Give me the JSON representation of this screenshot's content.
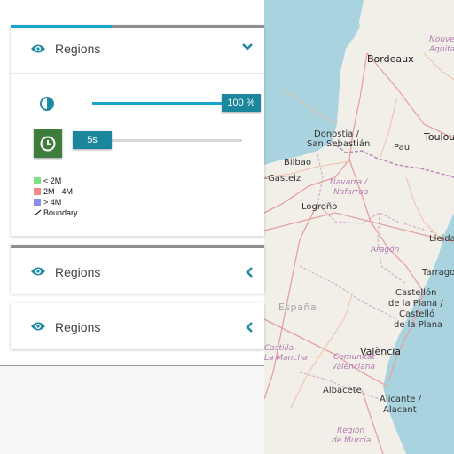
{
  "panel": {
    "layers": [
      {
        "title": "Regions",
        "expanded": true,
        "opacity_label": "100 %",
        "opacity_value": 1.0,
        "time_label": "5s",
        "time_position": 0.0,
        "load_progress": 0.4,
        "legend": [
          {
            "label": "< 2M",
            "color": "#7fe07f",
            "type": "fill"
          },
          {
            "label": "2M - 4M",
            "color": "#f08a8a",
            "type": "fill"
          },
          {
            "label": "> 4M",
            "color": "#8a8cf0",
            "type": "fill"
          },
          {
            "label": "Boundary",
            "color": "#000000",
            "type": "line"
          }
        ]
      },
      {
        "title": "Regions",
        "expanded": false
      },
      {
        "title": "Regions",
        "expanded": false
      }
    ]
  },
  "map": {
    "labels": {
      "bordeaux": "Bordeaux",
      "nouvelle": "Nouve",
      "aquitaine": "Aquita",
      "donostia": "Donostia /",
      "san_sebastian": "San Sebastián",
      "pau": "Pau",
      "toulouse": "Toulou",
      "bilbao": "Bilbao",
      "gasteiz": "-Gasteiz",
      "navarra": "Navarra /",
      "nafarroa": "Nafarroa",
      "logrono": "Logroño",
      "lleida": "Lleida",
      "aragon": "Aragón",
      "tarragona": "Tarrago",
      "espana": "España",
      "castellon1": "Castellón",
      "castellon2": "de la Plana /",
      "castellon3": "Castelló",
      "castellon4": "de la Plana",
      "castilla1": "Castilla-",
      "castilla2": "La Mancha",
      "valencia": "València",
      "comunitat1": "Comunitat",
      "comunitat2": "Valenciana",
      "albacete": "Albacete",
      "alicante1": "Alicante /",
      "alicante2": "Alacant",
      "murcia1": "Región",
      "murcia2": "de Murcia"
    }
  },
  "colors": {
    "accent": "#19a7c9",
    "tag": "#1c879c",
    "clock": "#3f7d3c",
    "sea": "#a9d3df"
  }
}
